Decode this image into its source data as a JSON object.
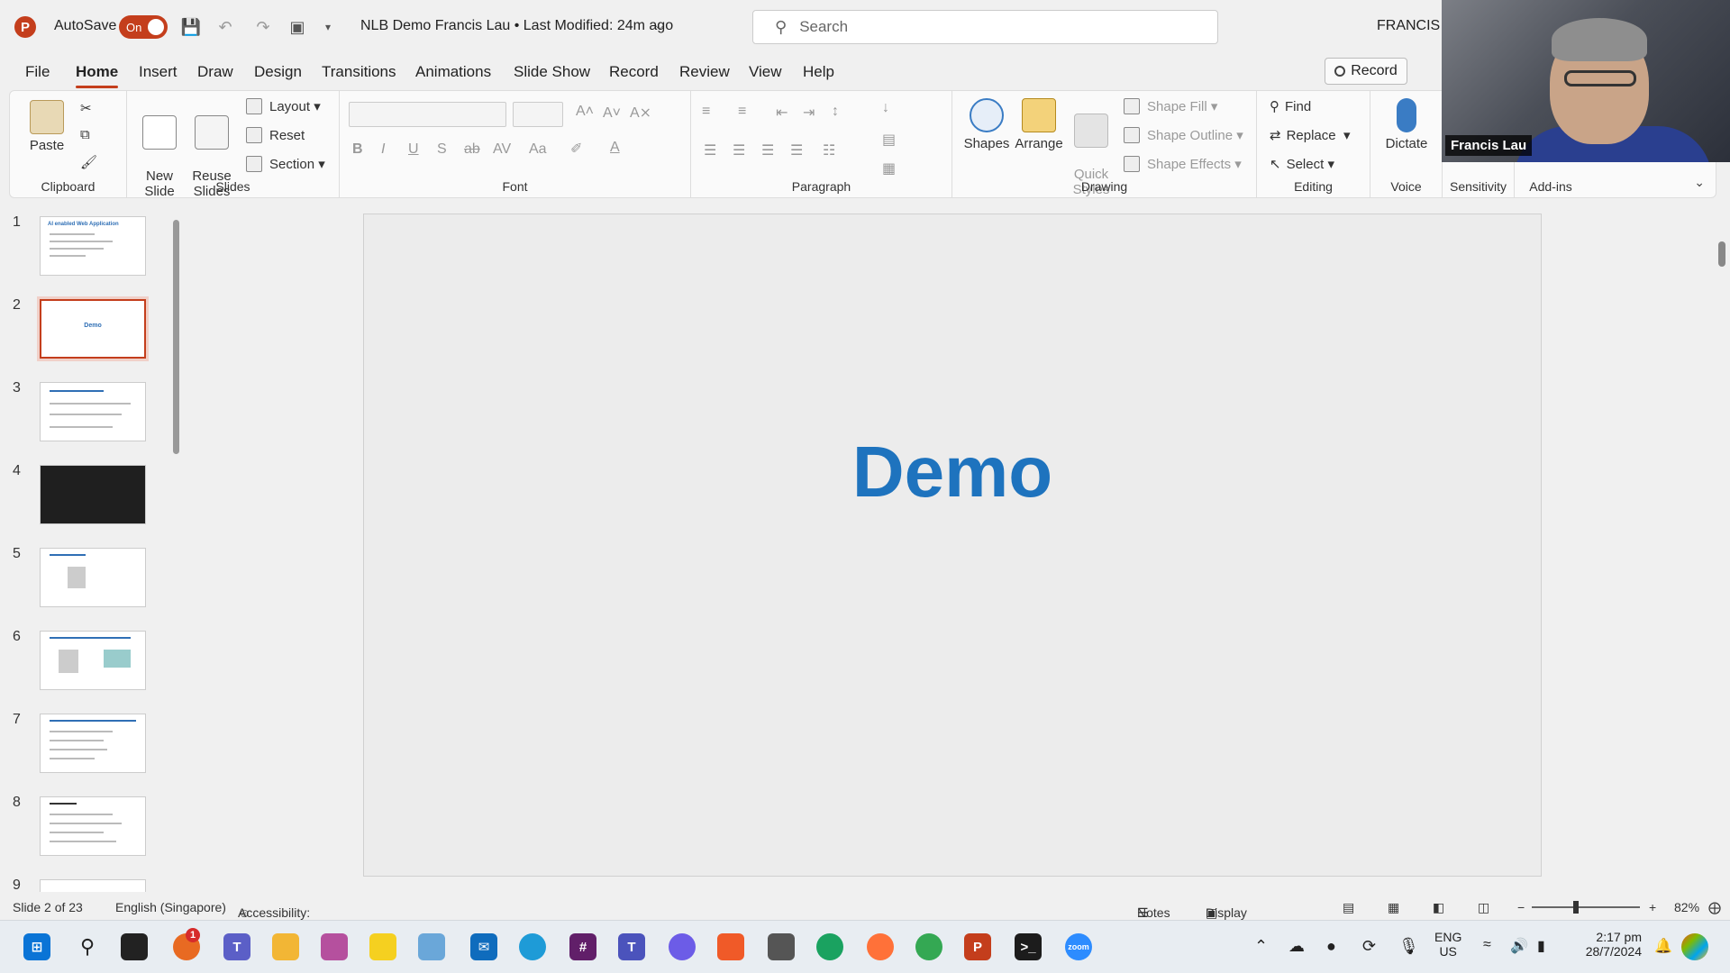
{
  "titlebar": {
    "app_logo": "P",
    "autosave_label": "AutoSave",
    "autosave_state": "On",
    "doc_title": "NLB Demo Francis Lau • Last Modified: 24m ago",
    "search_placeholder": "Search",
    "user": "FRANCIS LA"
  },
  "tabs": [
    "File",
    "Home",
    "Insert",
    "Draw",
    "Design",
    "Transitions",
    "Animations",
    "Slide Show",
    "Record",
    "Review",
    "View",
    "Help"
  ],
  "active_tab": "Home",
  "record_label": "Record",
  "ribbon": {
    "clipboard": {
      "label": "Clipboard",
      "paste": "Paste"
    },
    "slides": {
      "label": "Slides",
      "new_slide": "New\nSlide",
      "reuse_slides": "Reuse\nSlides",
      "layout": "Layout",
      "reset": "Reset",
      "section": "Section"
    },
    "font": {
      "label": "Font"
    },
    "paragraph": {
      "label": "Paragraph"
    },
    "drawing": {
      "label": "Drawing",
      "shapes": "Shapes",
      "arrange": "Arrange",
      "quick_styles": "Quick\nStyles",
      "shape_fill": "Shape Fill",
      "shape_outline": "Shape Outline",
      "shape_effects": "Shape Effects"
    },
    "editing": {
      "label": "Editing",
      "find": "Find",
      "replace": "Replace",
      "select": "Select"
    },
    "voice": {
      "label": "Voice",
      "dictate": "Dictate"
    },
    "sensitivity": {
      "label": "Sensitivity"
    },
    "addins": {
      "label": "Add-ins"
    }
  },
  "thumbnails": [
    {
      "num": "1",
      "title": "AI enabled Web Application"
    },
    {
      "num": "2",
      "title": "Demo",
      "selected": true
    },
    {
      "num": "3",
      "title": ""
    },
    {
      "num": "4",
      "title": ""
    },
    {
      "num": "5",
      "title": ""
    },
    {
      "num": "6",
      "title": ""
    },
    {
      "num": "7",
      "title": ""
    },
    {
      "num": "8",
      "title": ""
    },
    {
      "num": "9",
      "title": ""
    }
  ],
  "slide": {
    "title": "Demo"
  },
  "statusbar": {
    "slide_count": "Slide 2 of 23",
    "language": "English (Singapore)",
    "accessibility": "Accessibility: Investigate",
    "notes": "Notes",
    "display_settings": "Display Settings",
    "zoom": "82%"
  },
  "taskbar": {
    "lang_top": "ENG",
    "lang_bottom": "US",
    "time": "2:17 pm",
    "date": "28/7/2024",
    "notification_badge": "1"
  },
  "webcam": {
    "name": "Francis Lau"
  },
  "colors": {
    "accent": "#c43e1c",
    "slide_title": "#1e73be"
  }
}
